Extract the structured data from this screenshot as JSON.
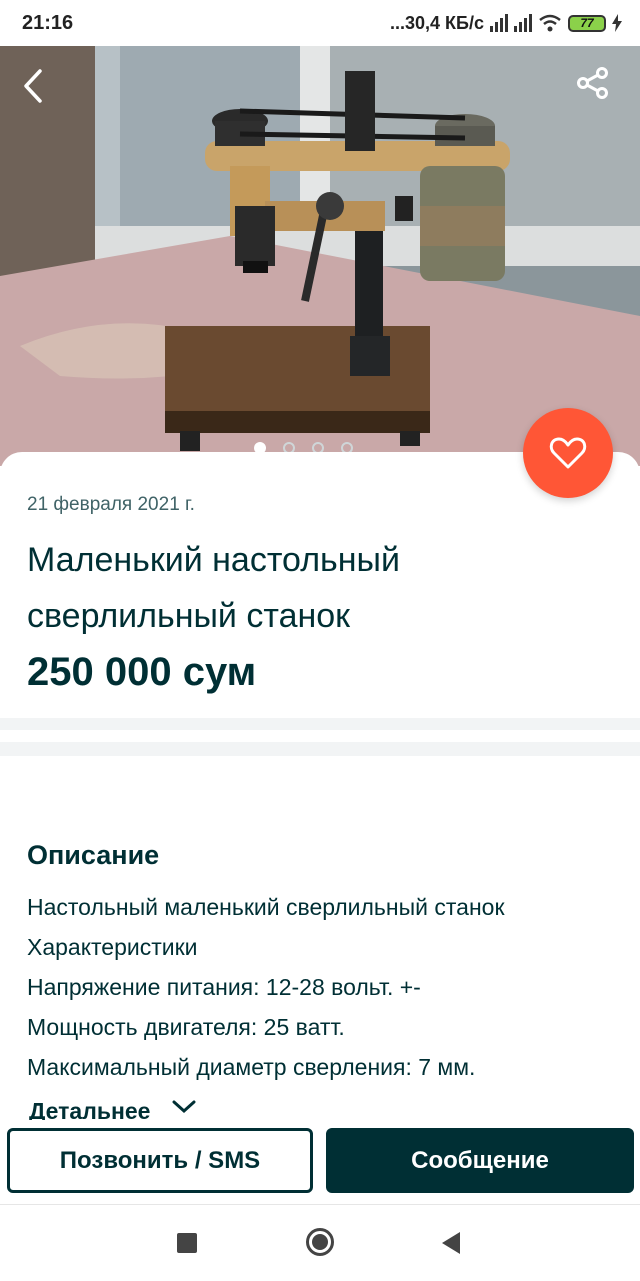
{
  "status_bar": {
    "time": "21:16",
    "network_speed": "...30,4 КБ/с",
    "battery_level": "77"
  },
  "listing": {
    "date": "21 февраля 2021 г.",
    "title": "Маленький настольный сверлильный станок",
    "price": "250 000 сум",
    "photo_count": 4,
    "active_photo_index": 0,
    "photo_description": "benchtop drill press on wooden base near window"
  },
  "description": {
    "heading": "Описание",
    "lines": [
      "Настольный маленький сверлильный станок",
      "Характеристики",
      "Напряжение питания: 12-28 вольт. +-",
      "Мощность двигателя: 25 ватт.",
      "Максимальный диаметр сверления: 7 мм."
    ],
    "more_label": "Детальнее"
  },
  "actions": {
    "call_label": "Позвонить / SMS",
    "message_label": "Сообщение"
  },
  "icons": {
    "back": "chevron-left-icon",
    "share": "share-icon",
    "favorite": "heart-icon",
    "more": "chevron-down-icon"
  },
  "colors": {
    "brand_dark": "#002f34",
    "favorite_accent": "#ff5636",
    "battery": "#8bd14a"
  }
}
